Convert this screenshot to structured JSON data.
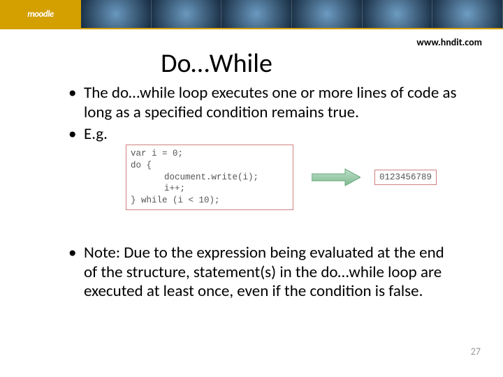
{
  "banner": {
    "logo_text": "moodle"
  },
  "url": "www.hndit.com",
  "title": "Do…While",
  "bullets": {
    "b1": "The do…while loop executes one or more lines of code as long as a specified condition remains true.",
    "b2": "E.g.",
    "b3": "Note: Due to the expression being evaluated at the end of the structure, statement(s) in the do…while loop are executed at least once, even if the condition is false."
  },
  "code": {
    "line1": "var i = 0;",
    "line2": "do {",
    "line3": "document.write(i);",
    "line4": "i++;",
    "line5": "} while (i < 10);"
  },
  "output": "0123456789",
  "page_number": "27"
}
